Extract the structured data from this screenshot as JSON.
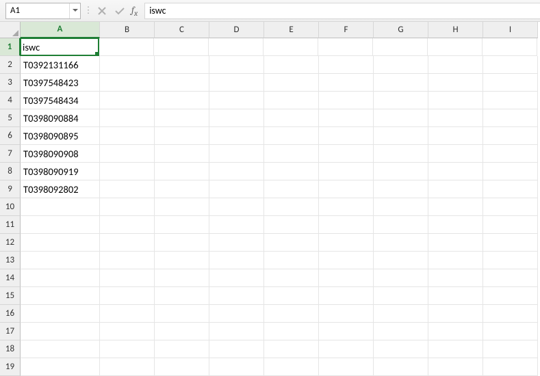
{
  "formula_bar": {
    "name_box": "A1",
    "formula": "iswc"
  },
  "columns": [
    "A",
    "B",
    "C",
    "D",
    "E",
    "F",
    "G",
    "H",
    "I"
  ],
  "active_col": "A",
  "row_count": 19,
  "active_row": 1,
  "cells": {
    "A1": "iswc",
    "A2": "T0392131166",
    "A3": "T0397548423",
    "A4": "T0397548434",
    "A5": "T0398090884",
    "A6": "T0398090895",
    "A7": "T0398090908",
    "A8": "T0398090919",
    "A9": "T0398092802"
  },
  "selected_cell": "A1"
}
